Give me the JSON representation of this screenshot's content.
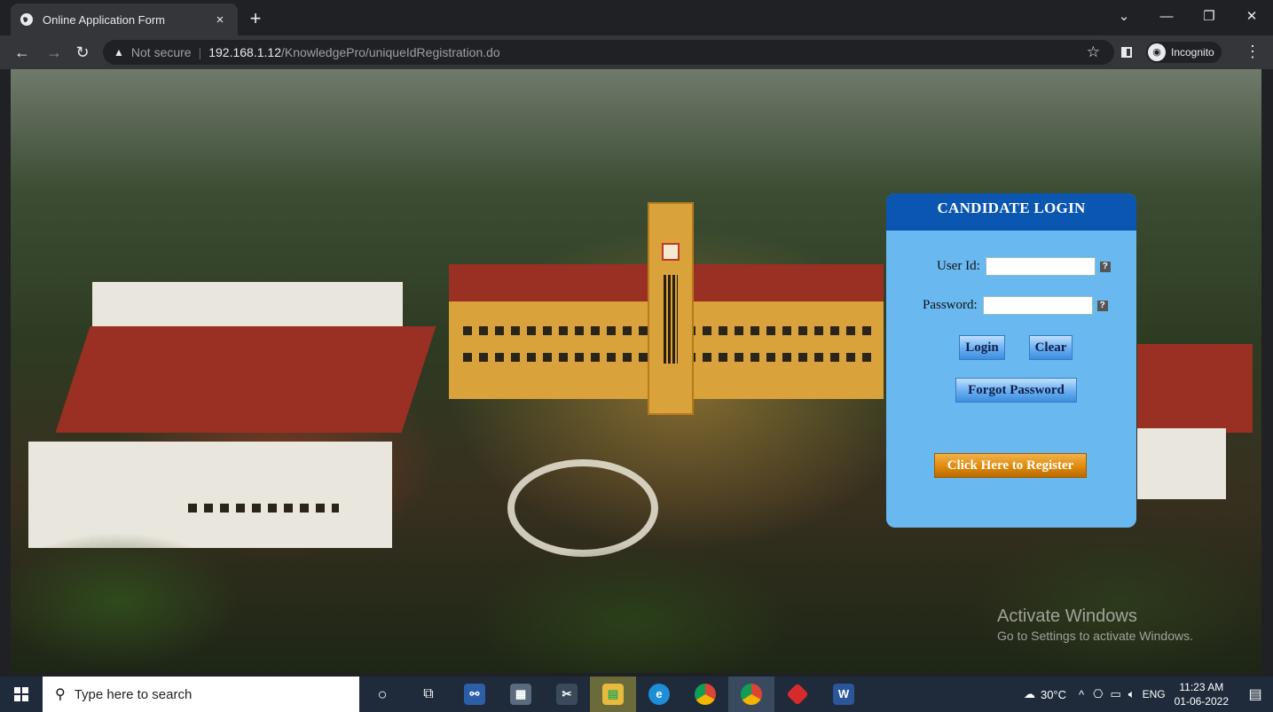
{
  "browser": {
    "tab_title": "Online Application Form",
    "tab_close": "×",
    "new_tab": "+",
    "security_label": "Not secure",
    "url_host": "192.168.1.12",
    "url_path": "/KnowledgePro/uniqueIdRegistration.do",
    "incognito_label": "Incognito",
    "window_controls": [
      "⌄",
      "—",
      "❐",
      "✕"
    ]
  },
  "login": {
    "header": "CANDIDATE LOGIN",
    "user_id_label": "User Id:",
    "user_id_value": "",
    "password_label": "Password:",
    "password_value": "",
    "help_glyph": "?",
    "login_button": "Login",
    "clear_button": "Clear",
    "forgot_button": "Forgot Password",
    "register_button": "Click Here to Register"
  },
  "watermark": {
    "line1": "Activate Windows",
    "line2": "Go to Settings to activate Windows."
  },
  "taskbar": {
    "search_placeholder": "Type here to search",
    "weather": "30°C",
    "language": "ENG",
    "time": "11:23 AM",
    "date": "01-06-2022"
  },
  "icons": {
    "favicon": "globe-icon",
    "back": "back-arrow-icon",
    "forward": "forward-arrow-icon",
    "reload": "reload-icon",
    "warning": "warning-icon",
    "star": "bookmark-star-icon",
    "menu": "kebab-menu-icon",
    "taskview": "task-view-icon",
    "notifications": "notifications-icon"
  },
  "colors": {
    "panel_bg": "#6ab8f0",
    "panel_header": "#0b56b0",
    "register_orange": "#e08a0c",
    "taskbar": "#1f2a3a"
  }
}
